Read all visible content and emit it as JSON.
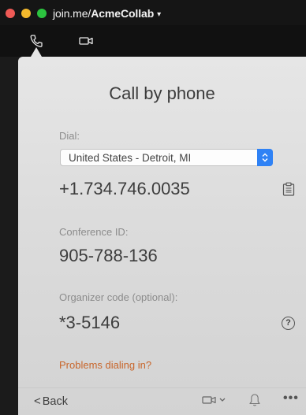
{
  "window": {
    "title_prefix": "join.me/",
    "title_bold": "AcmeCollab",
    "title_caret": "▾"
  },
  "tabs": [
    {
      "icon": "phone-icon",
      "active": true
    },
    {
      "icon": "video-camera-icon",
      "active": false
    }
  ],
  "call": {
    "heading": "Call by phone",
    "dial_label": "Dial:",
    "dial_selected": "United States - Detroit, MI",
    "phone_number": "+1.734.746.0035",
    "conference_label": "Conference ID:",
    "conference_id": "905-788-136",
    "organizer_label": "Organizer code (optional):",
    "organizer_code": "*3-5146",
    "help_glyph": "?",
    "problems_link": "Problems dialing in?"
  },
  "bottom": {
    "back_chevron": "<",
    "back_label": "Back",
    "more_glyph": "•••"
  },
  "colors": {
    "accent_link": "#c8652a",
    "select_stepper": "#2f82f5",
    "traffic_red": "#ef5a56",
    "traffic_yellow": "#f4b92d",
    "traffic_green": "#2cc33f"
  }
}
